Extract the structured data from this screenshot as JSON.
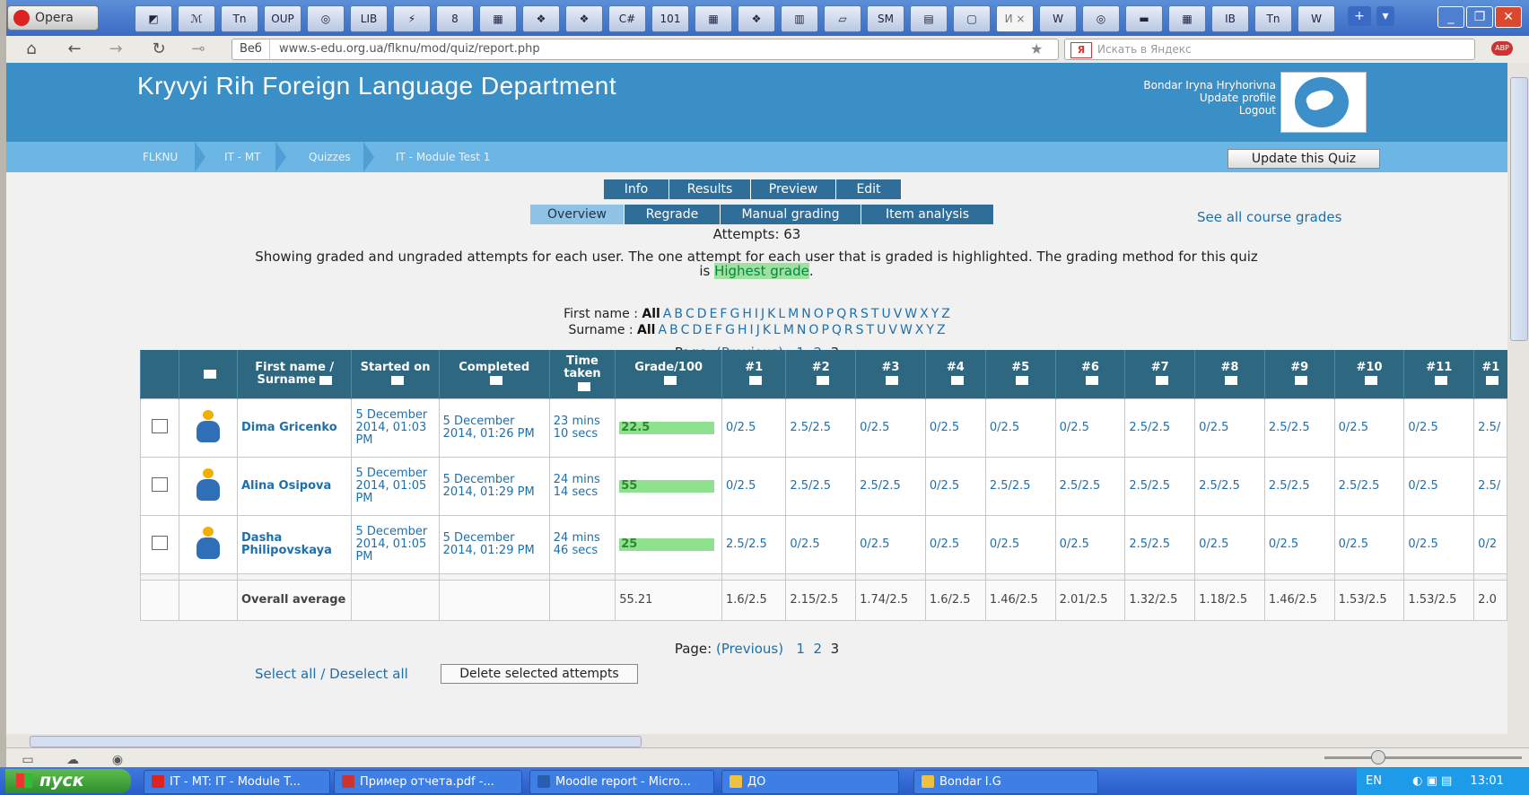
{
  "browser": {
    "opera_label": "Opera",
    "tabs": [
      "◩",
      "ℳ",
      "Tn",
      "OUP",
      "◎",
      "LIB",
      "⚡",
      "8",
      "▦",
      "❖",
      "❖",
      "C#",
      "101",
      "▦",
      "❖",
      "▥",
      "▱",
      "SM",
      "▤",
      "▢",
      "И ×",
      "W",
      "◎",
      "▬",
      "▦",
      "IB",
      "Tn",
      "W"
    ],
    "new_tab": "+",
    "menu_arrow": "▾",
    "window_controls": {
      "minimize": "_",
      "restore": "❐",
      "close": "✕"
    },
    "web_label": "Веб",
    "url": "www.s-edu.org.ua/flknu/mod/quiz/report.php",
    "search_placeholder": "Искать в Яндекс",
    "search_logo": "Я",
    "abp": "ABP"
  },
  "site": {
    "title": "Kryvyi Rih Foreign Language Department",
    "user_name": "Bondar Iryna Hryhorivna",
    "update_profile": "Update profile",
    "logout": "Logout",
    "breadcrumbs": [
      "FLKNU",
      "IT - MT",
      "Quizzes",
      "IT - Module Test 1"
    ],
    "update_quiz_button": "Update this Quiz"
  },
  "quiz_tabs": [
    "Info",
    "Results",
    "Preview",
    "Edit"
  ],
  "report_tabs": [
    "Overview",
    "Regrade",
    "Manual grading",
    "Item analysis"
  ],
  "see_all_grades": "See all course grades",
  "attempts_text": "Attempts: 63",
  "description": {
    "line1": "Showing graded and ungraded attempts for each user. The one attempt for each user that is graded is highlighted. The grading method for this quiz",
    "pre": "is ",
    "highlight": "Highest grade",
    "post": "."
  },
  "filters": {
    "first_name_label": "First name :",
    "surname_label": "Surname :",
    "all": "All",
    "letters": [
      "A",
      "B",
      "C",
      "D",
      "E",
      "F",
      "G",
      "H",
      "I",
      "J",
      "K",
      "L",
      "M",
      "N",
      "O",
      "P",
      "Q",
      "R",
      "S",
      "T",
      "U",
      "V",
      "W",
      "X",
      "Y",
      "Z"
    ]
  },
  "pager": {
    "label": "Page:",
    "previous": "(Previous)",
    "pages": [
      "1",
      "2",
      "3"
    ]
  },
  "table": {
    "headers": {
      "name": "First name / Surname",
      "started": "Started on",
      "completed": "Completed",
      "time": "Time taken",
      "grade": "Grade/100",
      "questions": [
        "#1",
        "#2",
        "#3",
        "#4",
        "#5",
        "#6",
        "#7",
        "#8",
        "#9",
        "#10",
        "#11",
        "#1"
      ]
    },
    "rows": [
      {
        "name": "Dima Gricenko",
        "started": "5 December 2014, 01:03 PM",
        "completed": "5 December 2014, 01:26 PM",
        "time": "23 mins 10 secs",
        "grade": "22.5",
        "grade_fraction": 0.225,
        "q": [
          "0/2.5",
          "2.5/2.5",
          "0/2.5",
          "0/2.5",
          "0/2.5",
          "0/2.5",
          "2.5/2.5",
          "0/2.5",
          "2.5/2.5",
          "0/2.5",
          "0/2.5",
          "2.5/"
        ]
      },
      {
        "name": "Alina Osipova",
        "started": "5 December 2014, 01:05 PM",
        "completed": "5 December 2014, 01:29 PM",
        "time": "24 mins 14 secs",
        "grade": "55",
        "grade_fraction": 0.55,
        "q": [
          "0/2.5",
          "2.5/2.5",
          "2.5/2.5",
          "0/2.5",
          "2.5/2.5",
          "2.5/2.5",
          "2.5/2.5",
          "2.5/2.5",
          "2.5/2.5",
          "2.5/2.5",
          "0/2.5",
          "2.5/"
        ]
      },
      {
        "name": "Dasha Philipovskaya",
        "started": "5 December 2014, 01:05 PM",
        "completed": "5 December 2014, 01:29 PM",
        "time": "24 mins 46 secs",
        "grade": "25",
        "grade_fraction": 0.25,
        "q": [
          "2.5/2.5",
          "0/2.5",
          "0/2.5",
          "0/2.5",
          "0/2.5",
          "0/2.5",
          "2.5/2.5",
          "0/2.5",
          "0/2.5",
          "0/2.5",
          "0/2.5",
          "0/2"
        ]
      }
    ],
    "average": {
      "label": "Overall average",
      "grade": "55.21",
      "q": [
        "1.6/2.5",
        "2.15/2.5",
        "1.74/2.5",
        "1.6/2.5",
        "1.46/2.5",
        "2.01/2.5",
        "1.32/2.5",
        "1.18/2.5",
        "1.46/2.5",
        "1.53/2.5",
        "1.53/2.5",
        "2.0"
      ]
    }
  },
  "select_all": "Select all / Deselect all",
  "delete_button": "Delete selected attempts",
  "taskbar": {
    "start": "пуск",
    "tasks": [
      {
        "label": "IT - MT: IT - Module T...",
        "color": "#d22"
      },
      {
        "label": "Пример отчета.pdf -...",
        "color": "#c33"
      },
      {
        "label": "Moodle report - Micro...",
        "color": "#2a5db0"
      },
      {
        "label": "ДО",
        "color": "#f0c040"
      },
      {
        "label": "Bondar I.G",
        "color": "#f0c040"
      }
    ],
    "lang": "EN",
    "clock": "13:01"
  }
}
